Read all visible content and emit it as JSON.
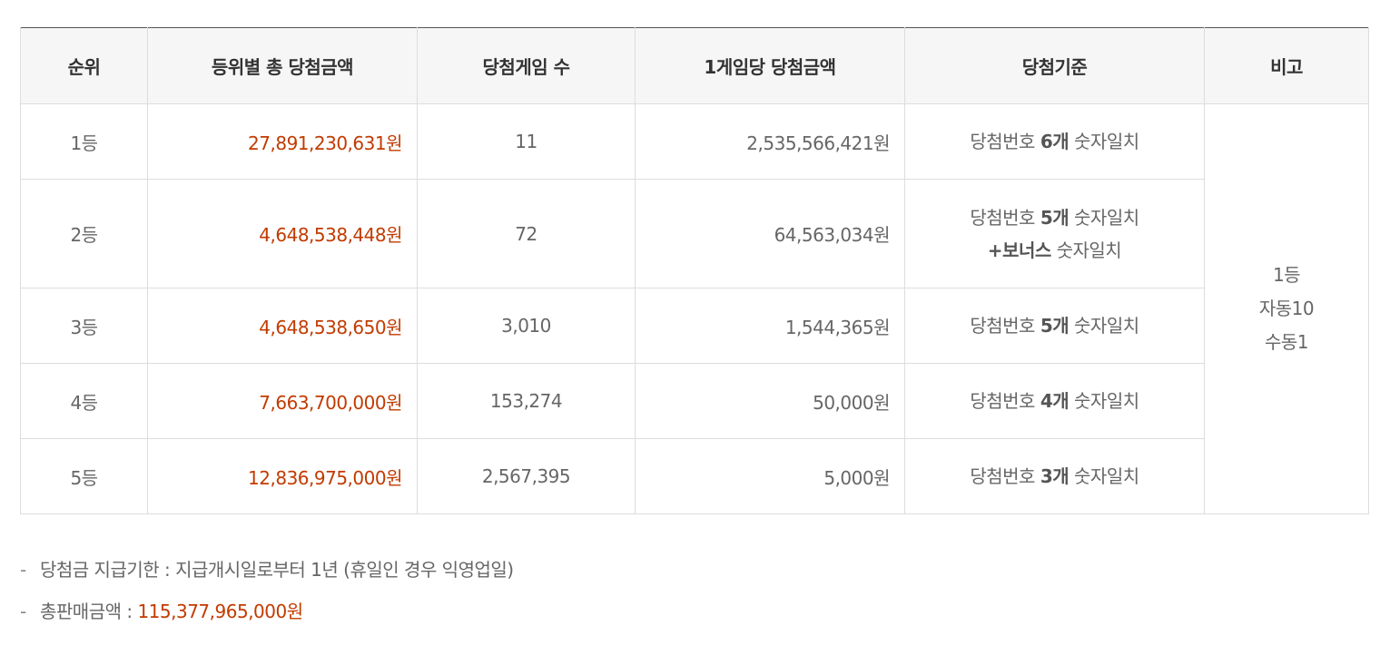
{
  "table": {
    "headers": [
      "순위",
      "등위별 총 당첨금액",
      "당첨게임 수",
      "1게임당 당첨금액",
      "당첨기준",
      "비고"
    ],
    "rows": [
      {
        "rank": "1등",
        "total": "27,891,230,631원",
        "winners": "11",
        "per_game": "2,535,566,421원",
        "criteria_pre": "당첨번호 ",
        "criteria_count": "6개",
        "criteria_post": " 숫자일치"
      },
      {
        "rank": "2등",
        "total": "4,648,538,448원",
        "winners": "72",
        "per_game": "64,563,034원",
        "criteria_pre": "당첨번호 ",
        "criteria_count": "5개",
        "criteria_post": " 숫자일치",
        "criteria2_bonus": "+보너스",
        "criteria2_post": " 숫자일치"
      },
      {
        "rank": "3등",
        "total": "4,648,538,650원",
        "winners": "3,010",
        "per_game": "1,544,365원",
        "criteria_pre": "당첨번호 ",
        "criteria_count": "5개",
        "criteria_post": " 숫자일치"
      },
      {
        "rank": "4등",
        "total": "7,663,700,000원",
        "winners": "153,274",
        "per_game": "50,000원",
        "criteria_pre": "당첨번호 ",
        "criteria_count": "4개",
        "criteria_post": " 숫자일치"
      },
      {
        "rank": "5등",
        "total": "12,836,975,000원",
        "winners": "2,567,395",
        "per_game": "5,000원",
        "criteria_pre": "당첨번호 ",
        "criteria_count": "3개",
        "criteria_post": " 숫자일치"
      }
    ],
    "remark": {
      "line1": "1등",
      "line2": "자동10",
      "line3": "수동1"
    }
  },
  "notes": {
    "dash": "-",
    "payment_deadline": "당첨금 지급기한 : 지급개시일로부터 1년 (휴일인 경우 익영업일)",
    "total_sales_label": "총판매금액 : ",
    "total_sales_value": "115,377,965,000원"
  },
  "colors": {
    "amount": "#c23b00",
    "header_bg": "#f6f6f6",
    "border": "#dddddd",
    "top_border": "#555555"
  }
}
